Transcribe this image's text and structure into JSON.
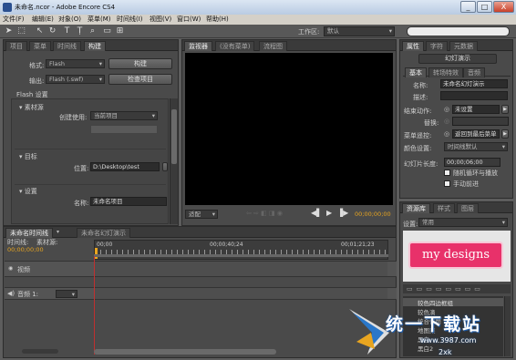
{
  "window": {
    "title": "未命名.ncor - Adobe Encore CS4",
    "minimize": "_",
    "maximize": "□",
    "close": "X"
  },
  "menu": [
    "文件(F)",
    "编辑(E)",
    "对象(O)",
    "菜单(M)",
    "时间线(I)",
    "视图(V)",
    "窗口(W)",
    "帮助(H)"
  ],
  "toolbar": {
    "workspace_label": "工作区:",
    "workspace_value": "默认"
  },
  "left_panel": {
    "tabs": [
      "项目",
      "菜单",
      "时间线",
      "构建"
    ],
    "format_label": "格式:",
    "format_value": "Flash",
    "build_button": "构建",
    "output_label": "输出:",
    "output_value": "Flash (.swf)",
    "check_button": "检查项目",
    "flash_settings": "Flash 设置",
    "source_section": "素材源",
    "create_using_label": "创建使用:",
    "create_using_value": "当前项目",
    "target_section": "目标",
    "location_label": "位置:",
    "location_value": "D:\\Desktop\\test",
    "settings_section": "设置",
    "name_label": "名称:",
    "name_value": "未命名项目"
  },
  "monitor": {
    "tabs": [
      "监视器",
      "(没有菜单)",
      "流程图"
    ],
    "zoom": "适配",
    "timecode": "00;00;00;00"
  },
  "properties": {
    "tabs": [
      "属性",
      "字符",
      "元数据"
    ],
    "slideshow_button": "幻灯演示",
    "subtabs": [
      "基本",
      "转场特效",
      "音频"
    ],
    "name_label": "名称:",
    "name_value": "未命名幻灯演示",
    "desc_label": "描述:",
    "end_action_label": "结束动作:",
    "end_action_value": "未设置",
    "override_label": "替换:",
    "menu_remote_label": "菜单遥控:",
    "menu_remote_value": "返回到最后菜单",
    "color_label": "颜色设置:",
    "color_value": "时间线默认",
    "duration_label": "幻灯片长度:",
    "duration_value": "00;00;06;00",
    "shuffle_label": "随机循环与播放",
    "manual_label": "手动前进"
  },
  "library": {
    "tabs": [
      "资源库",
      "样式",
      "图层"
    ],
    "set_label": "设置:",
    "set_value": "常用",
    "preview_text": "my designs",
    "items": [
      "较色四边框组",
      "较色滴",
      "统合信筒",
      "地图菜",
      "黑白",
      "黑白2"
    ]
  },
  "timeline": {
    "tabs": [
      "未命名时间线",
      "未命名幻灯演示"
    ],
    "timeline_label": "时间线:",
    "material_label": "素材源:",
    "current_time": "00;00;00;00",
    "ruler": [
      "00;00",
      "00;00;40;24",
      "00;01;21;23"
    ],
    "video_track": "视频",
    "audio_track": "音频 1:"
  },
  "watermark": {
    "site": "统一下载站",
    "url": "www.3987.com",
    "sub": "2xk"
  }
}
